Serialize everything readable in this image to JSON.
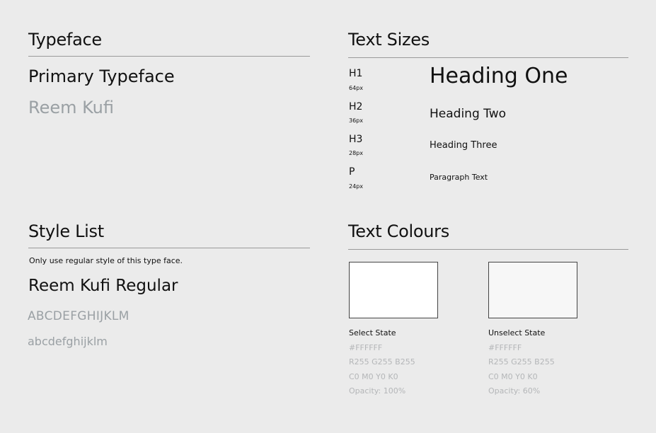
{
  "typeface": {
    "title": "Typeface",
    "primary_label": "Primary Typeface",
    "font_name": "Reem Kufi"
  },
  "style_list": {
    "title": "Style List",
    "note": "Only use regular style of this type face.",
    "style_name": "Reem Kufi Regular",
    "uppercase_sample": "ABCDEFGHIJKLM",
    "lowercase_sample": "abcdefghijklm"
  },
  "text_sizes": {
    "title": "Text Sizes",
    "rows": [
      {
        "tag": "H1",
        "size": "64px",
        "sample": "Heading One"
      },
      {
        "tag": "H2",
        "size": "36px",
        "sample": "Heading Two"
      },
      {
        "tag": "H3",
        "size": "28px",
        "sample": "Heading Three"
      },
      {
        "tag": "P",
        "size": "24px",
        "sample": "Paragraph Text"
      }
    ]
  },
  "text_colours": {
    "title": "Text Colours",
    "swatches": [
      {
        "state": "Select State",
        "hex": "#FFFFFF",
        "rgb": "R255 G255 B255",
        "cmyk": "C0 M0 Y0 K0",
        "opacity": "Opacity: 100%",
        "opacity_value": 1.0
      },
      {
        "state": "Unselect State",
        "hex": "#FFFFFF",
        "rgb": "R255 G255 B255",
        "cmyk": "C0 M0 Y0 K0",
        "opacity": "Opacity: 60%",
        "opacity_value": 0.6
      }
    ]
  },
  "colors": {
    "background": "#ebebeb",
    "text": "#111111",
    "muted_text": "#9aa0a4",
    "rule": "#9a9a9a"
  }
}
